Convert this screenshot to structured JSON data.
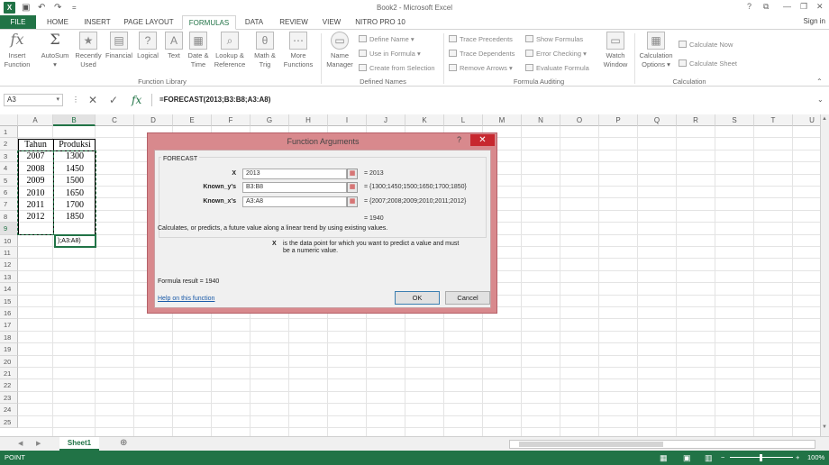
{
  "window": {
    "title": "Book2 - Microsoft Excel",
    "sign_in": "Sign in",
    "help_glyph": "?",
    "restore_glyph": "⧉",
    "minimize_glyph": "—",
    "maximize_glyph": "❐",
    "close_glyph": "✕",
    "app_icon": "X"
  },
  "qat": {
    "save_glyph": "💾",
    "undo_glyph": "↶",
    "redo_glyph": "↷",
    "customize_glyph": "="
  },
  "tabs": [
    "FILE",
    "HOME",
    "INSERT",
    "PAGE LAYOUT",
    "FORMULAS",
    "DATA",
    "REVIEW",
    "VIEW",
    "NITRO PRO 10"
  ],
  "ribbon": {
    "function_library": {
      "label": "Function Library",
      "buttons": [
        {
          "line1": "Insert",
          "line2": "Function",
          "glyph": "fx"
        },
        {
          "line1": "AutoSum",
          "line2": "",
          "glyph": "Σ"
        },
        {
          "line1": "Recently",
          "line2": "Used",
          "glyph": "★"
        },
        {
          "line1": "Financial",
          "line2": "",
          "glyph": "▤"
        },
        {
          "line1": "Logical",
          "line2": "",
          "glyph": "?"
        },
        {
          "line1": "Text",
          "line2": "",
          "glyph": "A"
        },
        {
          "line1": "Date &",
          "line2": "Time",
          "glyph": "▦"
        },
        {
          "line1": "Lookup &",
          "line2": "Reference",
          "glyph": "⌕"
        },
        {
          "line1": "Math &",
          "line2": "Trig",
          "glyph": "θ"
        },
        {
          "line1": "More",
          "line2": "Functions",
          "glyph": "⋯"
        }
      ]
    },
    "defined_names": {
      "label": "Defined Names",
      "name_manager": {
        "line1": "Name",
        "line2": "Manager"
      },
      "items": [
        "Define Name",
        "Use in Formula",
        "Create from Selection"
      ]
    },
    "formula_auditing": {
      "label": "Formula Auditing",
      "items": [
        "Trace Precedents",
        "Trace Dependents",
        "Remove Arrows",
        "Show Formulas",
        "Error Checking",
        "Evaluate Formula"
      ],
      "watch": {
        "line1": "Watch",
        "line2": "Window"
      }
    },
    "calculation": {
      "label": "Calculation",
      "options": {
        "line1": "Calculation",
        "line2": "Options"
      },
      "items": [
        "Calculate Now",
        "Calculate Sheet"
      ]
    }
  },
  "formula_bar": {
    "name_box": "A3",
    "formula": "=FORECAST(2013;B3:B8;A3:A8)",
    "cancel_glyph": "✕",
    "enter_glyph": "✓",
    "fx_glyph": "fx"
  },
  "grid": {
    "columns": [
      "A",
      "B",
      "C",
      "D",
      "E",
      "F",
      "G",
      "H",
      "I",
      "J",
      "K",
      "L",
      "M",
      "N",
      "O",
      "P",
      "Q",
      "R",
      "S",
      "T",
      "U"
    ],
    "rows": [
      "1",
      "2",
      "3",
      "4",
      "5",
      "6",
      "7",
      "8",
      "9",
      "10",
      "11",
      "12",
      "13",
      "14",
      "15",
      "16",
      "17",
      "18",
      "19",
      "20",
      "21",
      "22",
      "23",
      "24",
      "25"
    ],
    "header": [
      "Tahun",
      "Produksi"
    ],
    "data": [
      [
        "2007",
        "1300"
      ],
      [
        "2008",
        "1450"
      ],
      [
        "2009",
        "1500"
      ],
      [
        "2010",
        "1650"
      ],
      [
        "2011",
        "1700"
      ],
      [
        "2012",
        "1850"
      ]
    ],
    "editing_cell": ");A3:A8)"
  },
  "dialog": {
    "title": "Function Arguments",
    "help": "?",
    "close": "✕",
    "function_name": "FORECAST",
    "args": [
      {
        "label": "X",
        "value": "2013",
        "result": "= 2013"
      },
      {
        "label": "Known_y's",
        "value": "B3:B8",
        "result": "= {1300;1450;1500;1650;1700;1850}"
      },
      {
        "label": "Known_x's",
        "value": "A3:A8",
        "result": "= {2007;2008;2009;2010;2011;2012}"
      }
    ],
    "overall_result": "= 1940",
    "description": "Calculates, or predicts, a future value along a linear trend by using existing values.",
    "arg_desc_name": "X",
    "arg_desc_text_1": "is the data point for which you want to predict a value and must",
    "arg_desc_text_2": "be a numeric value.",
    "formula_result": "Formula result =   1940",
    "help_link": "Help on this function",
    "ok": "OK",
    "cancel": "Cancel"
  },
  "sheets": {
    "tabs": [
      "Sheet1"
    ],
    "add": "⊕",
    "prev": "◀",
    "next": "▶"
  },
  "status": {
    "mode": "POINT",
    "zoom": "100%"
  }
}
